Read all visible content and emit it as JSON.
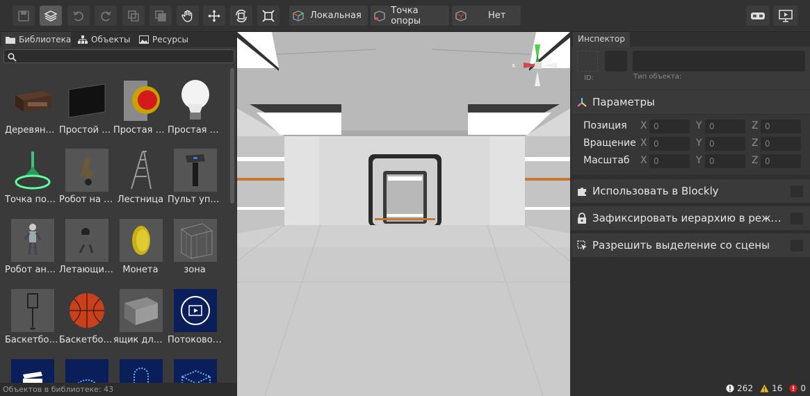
{
  "toolbar": {
    "coord_space": "Локальная",
    "pivot": "Точка опоры",
    "snap": "Нет"
  },
  "left_panel": {
    "tabs": [
      {
        "label": "Библиотека",
        "icon": "folder-icon"
      },
      {
        "label": "Объекты",
        "icon": "hierarchy-icon"
      },
      {
        "label": "Ресурсы",
        "icon": "image-icon"
      }
    ],
    "search_placeholder": "",
    "items": [
      {
        "name": "Деревянный стол"
      },
      {
        "name": "Простой экран"
      },
      {
        "name": "Простая кнопка"
      },
      {
        "name": "Простая лампа"
      },
      {
        "name": "Точка появления"
      },
      {
        "name": "Робот на колесах"
      },
      {
        "name": "Лестница"
      },
      {
        "name": "Пульт управления"
      },
      {
        "name": "Робот андроид"
      },
      {
        "name": "Летающий дрон"
      },
      {
        "name": "Монета"
      },
      {
        "name": "зона"
      },
      {
        "name": "Баскетбольное кольцо"
      },
      {
        "name": "Баскетбольный мяч"
      },
      {
        "name": "ящик для вещей"
      },
      {
        "name": "Потоковое видео"
      },
      {
        "name": ""
      },
      {
        "name": ""
      },
      {
        "name": ""
      },
      {
        "name": ""
      }
    ],
    "status": "Объектов в библиотеке: 43"
  },
  "viewport": {
    "gizmo_x": "x",
    "gizmo_y": "y"
  },
  "inspector": {
    "tab": "Инспектор",
    "id_label": "ID:",
    "type_label": "Тип объекта:",
    "params_title": "Параметры",
    "rows": [
      {
        "label": "Позиция",
        "x": "0",
        "y": "0",
        "z": "0"
      },
      {
        "label": "Вращение",
        "x": "0",
        "y": "0",
        "z": "0"
      },
      {
        "label": "Масштаб",
        "x": "0",
        "y": "0",
        "z": "0"
      }
    ],
    "axis_x": "X",
    "axis_y": "Y",
    "axis_z": "Z",
    "blockly": "Использовать в Blockly",
    "lock_hierarchy": "Зафиксировать иерархию в режиме",
    "allow_select": "Разрешить выделение со сцены"
  },
  "status": {
    "info": "262",
    "warnings": "16",
    "errors": "0"
  }
}
